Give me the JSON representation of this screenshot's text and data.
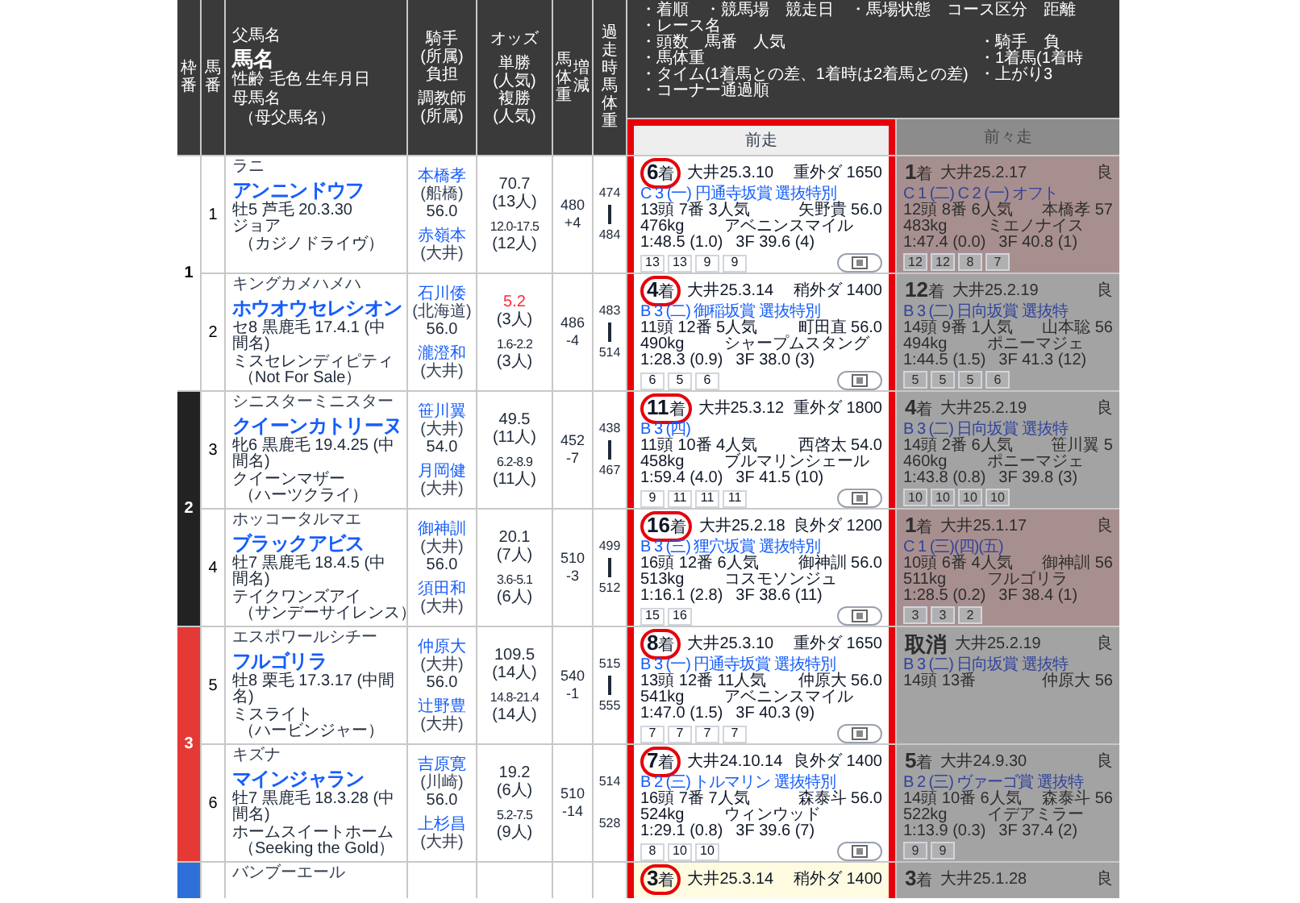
{
  "header": {
    "waku": "枠番",
    "umaban": "馬番",
    "horse": [
      "父馬名",
      "馬名",
      "性齢 毛色 生年月日",
      "母馬名",
      "（母父馬名）"
    ],
    "jockey": [
      "騎手",
      "(所属)",
      "負担",
      "調教師",
      "(所属)"
    ],
    "odds": [
      "オッズ",
      "単勝",
      "(人気)",
      "複勝",
      "(人気)"
    ],
    "weight": [
      "馬体重",
      "増減"
    ],
    "past_weight": "過走時馬体重",
    "legend": {
      "lines": [
        "・着順　・競馬場　競走日　・馬場状態　コース区分　距離",
        "・レース名"
      ],
      "left": [
        "・頭数　馬番　人気",
        "・馬体重",
        "・タイム(1着馬との差、1着時は2着馬との差)",
        "・コーナー通過順"
      ],
      "right": [
        "・騎手　負",
        "・1着馬(1着時",
        "・上がり3"
      ]
    },
    "columns": [
      {
        "label": "前走",
        "framed": true,
        "dimmed": false
      },
      {
        "label": "前々走",
        "framed": false,
        "dimmed": true
      }
    ]
  },
  "frames": [
    {
      "number": "1",
      "color": "#ffffff",
      "horses": [
        {
          "umaban": "1",
          "sire": "ラニ",
          "name": "アンニンドウフ",
          "profile": "牡5 芦毛 20.3.30",
          "dam": "ジョア",
          "damsire": "（カジノドライヴ）",
          "jockey": "本橋孝",
          "jockey_affil": "(船橋)",
          "burden": "56.0",
          "trainer": "赤嶺本",
          "trainer_affil": "(大井)",
          "win_odds": "70.7",
          "win_hot": false,
          "win_pop": "(13人)",
          "place_odds": "12.0-17.5",
          "place_pop": "(12人)",
          "weight": "480",
          "weight_diff": "+4",
          "past_weights": [
            "474",
            "484"
          ],
          "range_bar": true,
          "races": [
            {
              "place": "6",
              "suffix": "着",
              "circled": true,
              "venue_date": "大井25.3.10",
              "course": "重外ダ 1650",
              "race": "C 3 (一) 円通寺坂賞 選抜特別",
              "field": "13頭 7番 3人気",
              "rider": "矢野貴 56.0",
              "body_weight": "476kg",
              "winner": "アベニンスマイル",
              "time": "1:48.5 (1.0)",
              "last3f": "3F 39.6 (4)",
              "corners": [
                "13",
                "13",
                "9",
                "9"
              ],
              "video": true
            },
            {
              "place": "1",
              "suffix": "着",
              "circled": false,
              "color": "#a88f8f",
              "venue_date": "大井25.2.17",
              "course": "良",
              "race": "C 1 (二) C 2 (一) オフト",
              "field": "12頭 8番 6人気",
              "rider": "本橋孝 57",
              "body_weight": "483kg",
              "winner": "ミエノナイス",
              "time": "1:47.4 (0.0)",
              "last3f": "3F 40.8 (1)",
              "corners": [
                "12",
                "12",
                "8",
                "7"
              ],
              "video": false
            }
          ]
        },
        {
          "umaban": "2",
          "sire": "キングカメハメハ",
          "name": "ホウオウセレシオン",
          "profile": "セ8 黒鹿毛 17.4.1 (中間名)",
          "dam": "ミスセレンディピティ",
          "damsire": "（Not For Sale）",
          "jockey": "石川倭",
          "jockey_affil": "(北海道)",
          "burden": "56.0",
          "trainer": "瀧澄和",
          "trainer_affil": "(大井)",
          "win_odds": "5.2",
          "win_hot": true,
          "win_pop": "(3人)",
          "place_odds": "1.6-2.2",
          "place_pop": "(3人)",
          "weight": "486",
          "weight_diff": "-4",
          "past_weights": [
            "483",
            "514"
          ],
          "range_bar": true,
          "races": [
            {
              "place": "4",
              "suffix": "着",
              "circled": true,
              "venue_date": "大井25.3.14",
              "course": "稍外ダ 1400",
              "race": "B 3 (二) 御稲坂賞 選抜特別",
              "field": "11頭 12番 5人気",
              "rider": "町田直 56.0",
              "body_weight": "490kg",
              "winner": "シャープムスタング",
              "time": "1:28.3 (0.9)",
              "last3f": "3F 38.0 (3)",
              "corners": [
                "6",
                "5",
                "6"
              ],
              "video": true
            },
            {
              "place": "12",
              "suffix": "着",
              "circled": false,
              "venue_date": "大井25.2.19",
              "course": "良",
              "race": "B 3 (二) 日向坂賞 選抜特",
              "field": "14頭 9番 1人気",
              "rider": "山本聡 56",
              "body_weight": "494kg",
              "winner": "ポニーマジェ",
              "time": "1:44.5 (1.5)",
              "last3f": "3F 41.3 (12)",
              "corners": [
                "5",
                "5",
                "5",
                "6"
              ],
              "video": false
            }
          ]
        }
      ]
    },
    {
      "number": "2",
      "color": "#222222",
      "horses": [
        {
          "umaban": "3",
          "sire": "シニスターミニスター",
          "name": "クイーンカトリーヌ",
          "profile": "牝6 黒鹿毛 19.4.25 (中間名)",
          "dam": "クイーンマザー",
          "damsire": "（ハーツクライ）",
          "jockey": "笹川翼",
          "jockey_affil": "(大井)",
          "burden": "54.0",
          "trainer": "月岡健",
          "trainer_affil": "(大井)",
          "win_odds": "49.5",
          "win_hot": false,
          "win_pop": "(11人)",
          "place_odds": "6.2-8.9",
          "place_pop": "(11人)",
          "weight": "452",
          "weight_diff": "-7",
          "past_weights": [
            "438",
            "467"
          ],
          "range_bar": true,
          "races": [
            {
              "place": "11",
              "suffix": "着",
              "circled": true,
              "venue_date": "大井25.3.12",
              "course": "重外ダ 1800",
              "race": "B 3 (四)",
              "field": "11頭 10番 4人気",
              "rider": "西啓太 54.0",
              "body_weight": "458kg",
              "winner": "ブルマリンシェール",
              "time": "1:59.4 (4.0)",
              "last3f": "3F 41.5 (10)",
              "corners": [
                "9",
                "11",
                "11",
                "11"
              ],
              "video": true
            },
            {
              "place": "4",
              "suffix": "着",
              "circled": false,
              "venue_date": "大井25.2.19",
              "course": "良",
              "race": "B 3 (二) 日向坂賞 選抜特",
              "field": "14頭 2番 6人気",
              "rider": "笹川翼 5",
              "body_weight": "460kg",
              "winner": "ポニーマジェ",
              "time": "1:43.8 (0.8)",
              "last3f": "3F 39.8 (3)",
              "corners": [
                "10",
                "10",
                "10",
                "10"
              ],
              "video": false
            }
          ]
        },
        {
          "umaban": "4",
          "sire": "ホッコータルマエ",
          "name": "ブラックアビス",
          "profile": "牡7 黒鹿毛 18.4.5 (中間名)",
          "dam": "テイクワンズアイ",
          "damsire": "（サンデーサイレンス）",
          "jockey": "御神訓",
          "jockey_affil": "(大井)",
          "burden": "56.0",
          "trainer": "須田和",
          "trainer_affil": "(大井)",
          "win_odds": "20.1",
          "win_hot": false,
          "win_pop": "(7人)",
          "place_odds": "3.6-5.1",
          "place_pop": "(6人)",
          "weight": "510",
          "weight_diff": "-3",
          "past_weights": [
            "499",
            "512"
          ],
          "range_bar": true,
          "races": [
            {
              "place": "16",
              "suffix": "着",
              "circled": true,
              "venue_date": "大井25.2.18",
              "course": "良外ダ 1200",
              "race": "B 3 (三) 狸穴坂賞 選抜特別",
              "field": "16頭 12番 6人気",
              "rider": "御神訓 56.0",
              "body_weight": "513kg",
              "winner": "コスモソンジュ",
              "time": "1:16.1 (2.8)",
              "last3f": "3F 38.6 (11)",
              "corners": [
                "15",
                "16"
              ],
              "video": true
            },
            {
              "place": "1",
              "suffix": "着",
              "circled": false,
              "color": "#a88f8f",
              "venue_date": "大井25.1.17",
              "course": "良",
              "race": "C 1 (三)(四)(五)",
              "field": "10頭 6番 4人気",
              "rider": "御神訓 56",
              "body_weight": "511kg",
              "winner": "フルゴリラ",
              "time": "1:28.5 (0.2)",
              "last3f": "3F 38.4 (1)",
              "corners": [
                "3",
                "3",
                "2"
              ],
              "video": false
            }
          ]
        }
      ]
    },
    {
      "number": "3",
      "color": "#e53935",
      "horses": [
        {
          "umaban": "5",
          "sire": "エスポワールシチー",
          "name": "フルゴリラ",
          "profile": "牡8 栗毛 17.3.17 (中間名)",
          "dam": "ミスライト",
          "damsire": "（ハービンジャー）",
          "jockey": "仲原大",
          "jockey_affil": "(大井)",
          "burden": "56.0",
          "trainer": "辻野豊",
          "trainer_affil": "(大井)",
          "win_odds": "109.5",
          "win_hot": false,
          "win_pop": "(14人)",
          "place_odds": "14.8-21.4",
          "place_pop": "(14人)",
          "weight": "540",
          "weight_diff": "-1",
          "past_weights": [
            "515",
            "555"
          ],
          "range_bar": true,
          "races": [
            {
              "place": "8",
              "suffix": "着",
              "circled": true,
              "venue_date": "大井25.3.10",
              "course": "重外ダ 1650",
              "race": "B 3 (一) 円通寺坂賞 選抜特別",
              "field": "13頭 12番 11人気",
              "rider": "仲原大 56.0",
              "body_weight": "541kg",
              "winner": "アベニンスマイル",
              "time": "1:47.0 (1.5)",
              "last3f": "3F 40.3 (9)",
              "corners": [
                "7",
                "7",
                "7",
                "7"
              ],
              "video": true
            },
            {
              "place": "取消",
              "circled": false,
              "venue_date": "大井25.2.19",
              "course": "良",
              "race": "B 3 (二) 日向坂賞 選抜特",
              "field": "14頭 13番",
              "rider": "仲原大 56",
              "video": false
            }
          ]
        },
        {
          "umaban": "6",
          "sire": "キズナ",
          "name": "マインジャラン",
          "profile": "牡7 黒鹿毛 18.3.28 (中間名)",
          "dam": "ホームスイートホーム",
          "damsire": "（Seeking the Gold）",
          "jockey": "吉原寛",
          "jockey_affil": "(川崎)",
          "burden": "56.0",
          "trainer": "上杉昌",
          "trainer_affil": "(大井)",
          "win_odds": "19.2",
          "win_hot": false,
          "win_pop": "(6人)",
          "place_odds": "5.2-7.5",
          "place_pop": "(9人)",
          "weight": "510",
          "weight_diff": "-14",
          "past_weights": [
            "514",
            "528"
          ],
          "range_bar": false,
          "races": [
            {
              "place": "7",
              "suffix": "着",
              "circled": true,
              "venue_date": "大井24.10.14",
              "course": "良外ダ 1400",
              "race": "B 2 (三) トルマリン 選抜特別",
              "field": "16頭 7番 7人気",
              "rider": "森泰斗 56.0",
              "body_weight": "524kg",
              "winner": "ウィンウッド",
              "time": "1:29.1 (0.8)",
              "last3f": "3F 39.6 (7)",
              "corners": [
                "8",
                "10",
                "10"
              ],
              "video": true
            },
            {
              "place": "5",
              "suffix": "着",
              "circled": false,
              "venue_date": "大井24.9.30",
              "course": "良",
              "race": "B 2 (三) ヴァーゴ賞 選抜特",
              "field": "14頭 10番 6人気",
              "rider": "森泰斗 56",
              "body_weight": "522kg",
              "winner": "イデアミラー",
              "time": "1:13.9 (0.3)",
              "last3f": "3F 37.4 (2)",
              "corners": [
                "9",
                "9"
              ],
              "video": false
            }
          ]
        }
      ]
    },
    {
      "color": "#2f6fd8",
      "horses": [
        {
          "sire": "バンブーエール",
          "races": [
            {
              "place": "3",
              "suffix": "着",
              "circled": true,
              "color": "#fffbe0",
              "venue_date": "大井25.3.14",
              "course": "稍外ダ 1400",
              "video": false
            },
            {
              "place": "3",
              "suffix": "着",
              "circled": false,
              "venue_date": "大井25.1.28",
              "course": "良",
              "video": false
            }
          ]
        }
      ]
    }
  ]
}
